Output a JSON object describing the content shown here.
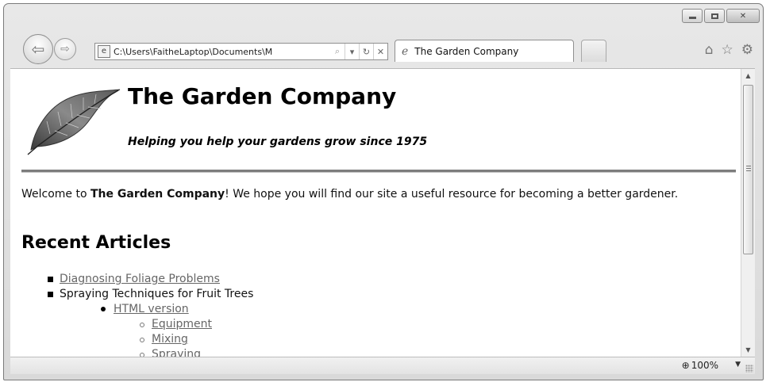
{
  "window": {
    "controls": {
      "minimize_icon": "minimize-icon",
      "maximize_icon": "maximize-icon",
      "close_glyph": "✕"
    }
  },
  "nav": {
    "back_glyph": "⇦",
    "forward_glyph": "⇨",
    "address": "C:\\Users\\FaitheLaptop\\Documents\\M",
    "search_glyph": "⌕",
    "dropdown_glyph": "▾",
    "refresh_glyph": "↻",
    "stop_glyph": "✕"
  },
  "tab": {
    "title": "The Garden Company",
    "icon": "ie-icon"
  },
  "toolbar_icons": {
    "home": "⌂",
    "favorites": "☆",
    "tools": "⚙"
  },
  "page": {
    "title": "The Garden Company",
    "tagline": "Helping you help your gardens grow since 1975",
    "welcome_prefix": "Welcome to ",
    "welcome_bold": "The Garden Company",
    "welcome_suffix": "! We hope you will find our site a useful resource for becoming a better gardener.",
    "recent_heading": "Recent Articles",
    "articles": {
      "item1": "Diagnosing Foliage Problems",
      "item2": "Spraying Techniques for Fruit Trees",
      "html_version": "HTML version",
      "equipment": "Equipment",
      "mixing": "Mixing",
      "cut_off": "Spraying"
    }
  },
  "scrollbar": {
    "up_glyph": "▲",
    "down_glyph": "▼"
  },
  "status": {
    "zoom": "100%",
    "zoom_icon_glyph": "⊕",
    "zoom_dropdown": "▼"
  },
  "colors": {
    "link": "#666666",
    "rule": "#7d7d7d",
    "chrome": "#dcdcdc"
  }
}
